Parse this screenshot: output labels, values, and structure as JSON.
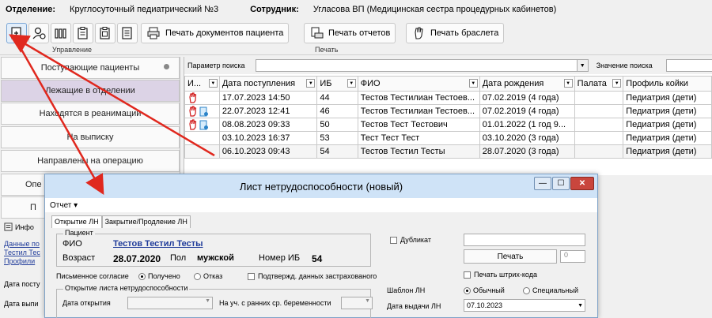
{
  "header": {
    "department_label": "Отделение:",
    "department_value": "Круглосуточный педиатрический №3",
    "employee_label": "Сотрудник:",
    "employee_value": "Угласова ВП (Медицинская сестра процедурных кабинетов)"
  },
  "toolbar": {
    "group_manage": "Управление",
    "group_print": "Печать",
    "print_patient_docs": "Печать документов пациента",
    "print_reports": "Печать отчетов",
    "print_bracelet": "Печать браслета"
  },
  "sidebar": {
    "items": [
      {
        "label": "Поступающие пациенты"
      },
      {
        "label": "Лежащие в отделении"
      },
      {
        "label": "Находятся в реанимации"
      },
      {
        "label": "На выписку"
      },
      {
        "label": "Направлены на операцию"
      },
      {
        "label": "Опе"
      },
      {
        "label": "П"
      }
    ],
    "info_header": "Инфо",
    "info_line1": "Данные по",
    "info_line2": "Тестил Тес",
    "info_line3": "Профили",
    "admission_label": "Дата посту",
    "discharge_label": "Дата выпи"
  },
  "search": {
    "param_label": "Параметр поиска",
    "value_label": "Значение поиска"
  },
  "table": {
    "columns": [
      "И...",
      "Дата поступления",
      "ИБ",
      "ФИО",
      "Дата рождения",
      "Палата",
      "Профиль койки"
    ],
    "rows": [
      {
        "date": "17.07.2023 14:50",
        "ib": "44",
        "fio": "Тестов Тестилиан Тестоев...",
        "birth": "07.02.2019 (4 года)",
        "room": "",
        "profile": "Педиатрия (дети)"
      },
      {
        "date": "22.07.2023 12:41",
        "ib": "46",
        "fio": "Тестов Тестилиан Тестоев...",
        "birth": "07.02.2019 (4 года)",
        "room": "",
        "profile": "Педиатрия (дети)"
      },
      {
        "date": "08.08.2023 09:33",
        "ib": "50",
        "fio": "Тестов Тест Тестович",
        "birth": "01.01.2022 (1 год 9...",
        "room": "",
        "profile": "Педиатрия (дети)"
      },
      {
        "date": "03.10.2023 16:37",
        "ib": "53",
        "fio": "Тест Тест Тест",
        "birth": "03.10.2020 (3 года)",
        "room": "",
        "profile": "Педиатрия (дети)"
      },
      {
        "date": "06.10.2023 09:43",
        "ib": "54",
        "fio": "Тестов Тестил Тесты",
        "birth": "28.07.2020 (3 года)",
        "room": "",
        "profile": "Педиатрия (дети)"
      }
    ]
  },
  "dialog": {
    "title": "Лист нетрудоспособности (новый)",
    "menu_report": "Отчет ▾",
    "tab_open": "Открытие ЛН",
    "tab_close": "Закрытие/Продление ЛН",
    "patient_legend": "Пациент",
    "fio_label": "ФИО",
    "fio_value": "Тестов Тестил Тесты",
    "age_label": "Возраст",
    "age_value": "28.07.2020",
    "sex_label": "Пол",
    "sex_value": "мужской",
    "ib_label": "Номер ИБ",
    "ib_value": "54",
    "consent_label": "Письменное согласие",
    "consent_received": "Получено",
    "consent_refused": "Отказ",
    "insured_confirm": "Подтвержд. данных застрахованого",
    "opening_legend": "Открытие листа нетрудоспособности",
    "open_date_label": "Дата открытия",
    "pregnancy_label": "На уч. с ранних ср. беременности",
    "duplicate_label": "Дубликат",
    "print_button": "Печать",
    "print_count": "0",
    "print_barcode": "Печать штрих-кода",
    "template_label": "Шаблон ЛН",
    "template_normal": "Обычный",
    "template_special": "Специальный",
    "issue_date_label": "Дата выдачи ЛН",
    "issue_date_value": "07.10.2023"
  },
  "colors": {
    "annotation_arrow": "#e0281e",
    "active_sidebar": "#dcd3e6",
    "link": "#1f3b9a"
  }
}
